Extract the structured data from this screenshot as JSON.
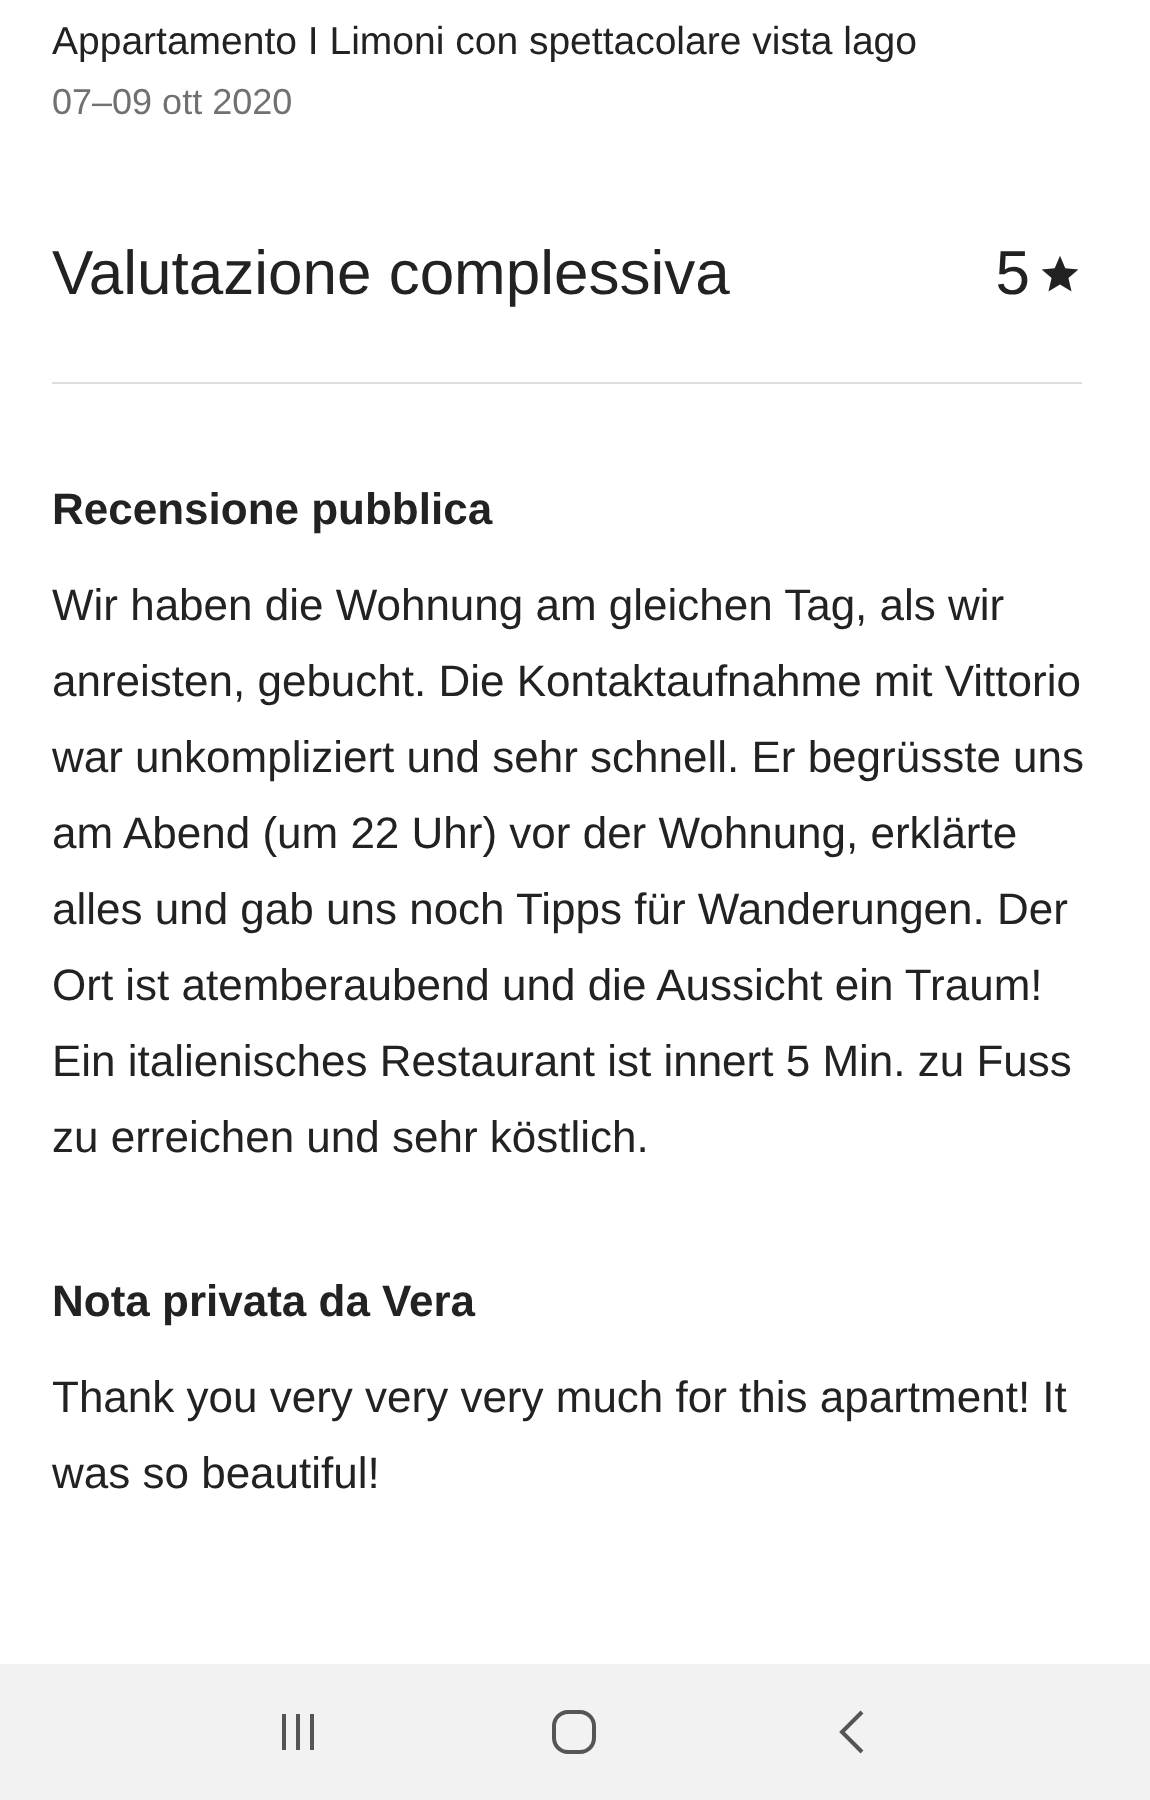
{
  "listing": {
    "title": "Appartamento I Limoni con spettacolare vista lago",
    "dates": "07–09 ott 2020"
  },
  "overall": {
    "title": "Valutazione complessiva",
    "rating": "5"
  },
  "sections": [
    {
      "heading": "Recensione pubblica",
      "text": "Wir haben die Wohnung am gleichen Tag, als wir anreisten, gebucht. Die Kontaktaufnahme mit Vittorio war unkompliziert und sehr schnell. Er begrüsste uns am Abend (um 22 Uhr) vor der Wohnung, erklärte alles und gab uns noch Tipps für Wanderungen. Der Ort ist atemberaubend und die Aussicht ein Traum! Ein italienisches Restaurant ist innert 5 Min. zu Fuss zu erreichen und sehr köstlich."
    },
    {
      "heading": "Nota privata da Vera",
      "text": "Thank you very very very much for this apartment! It was so beautiful!"
    }
  ]
}
